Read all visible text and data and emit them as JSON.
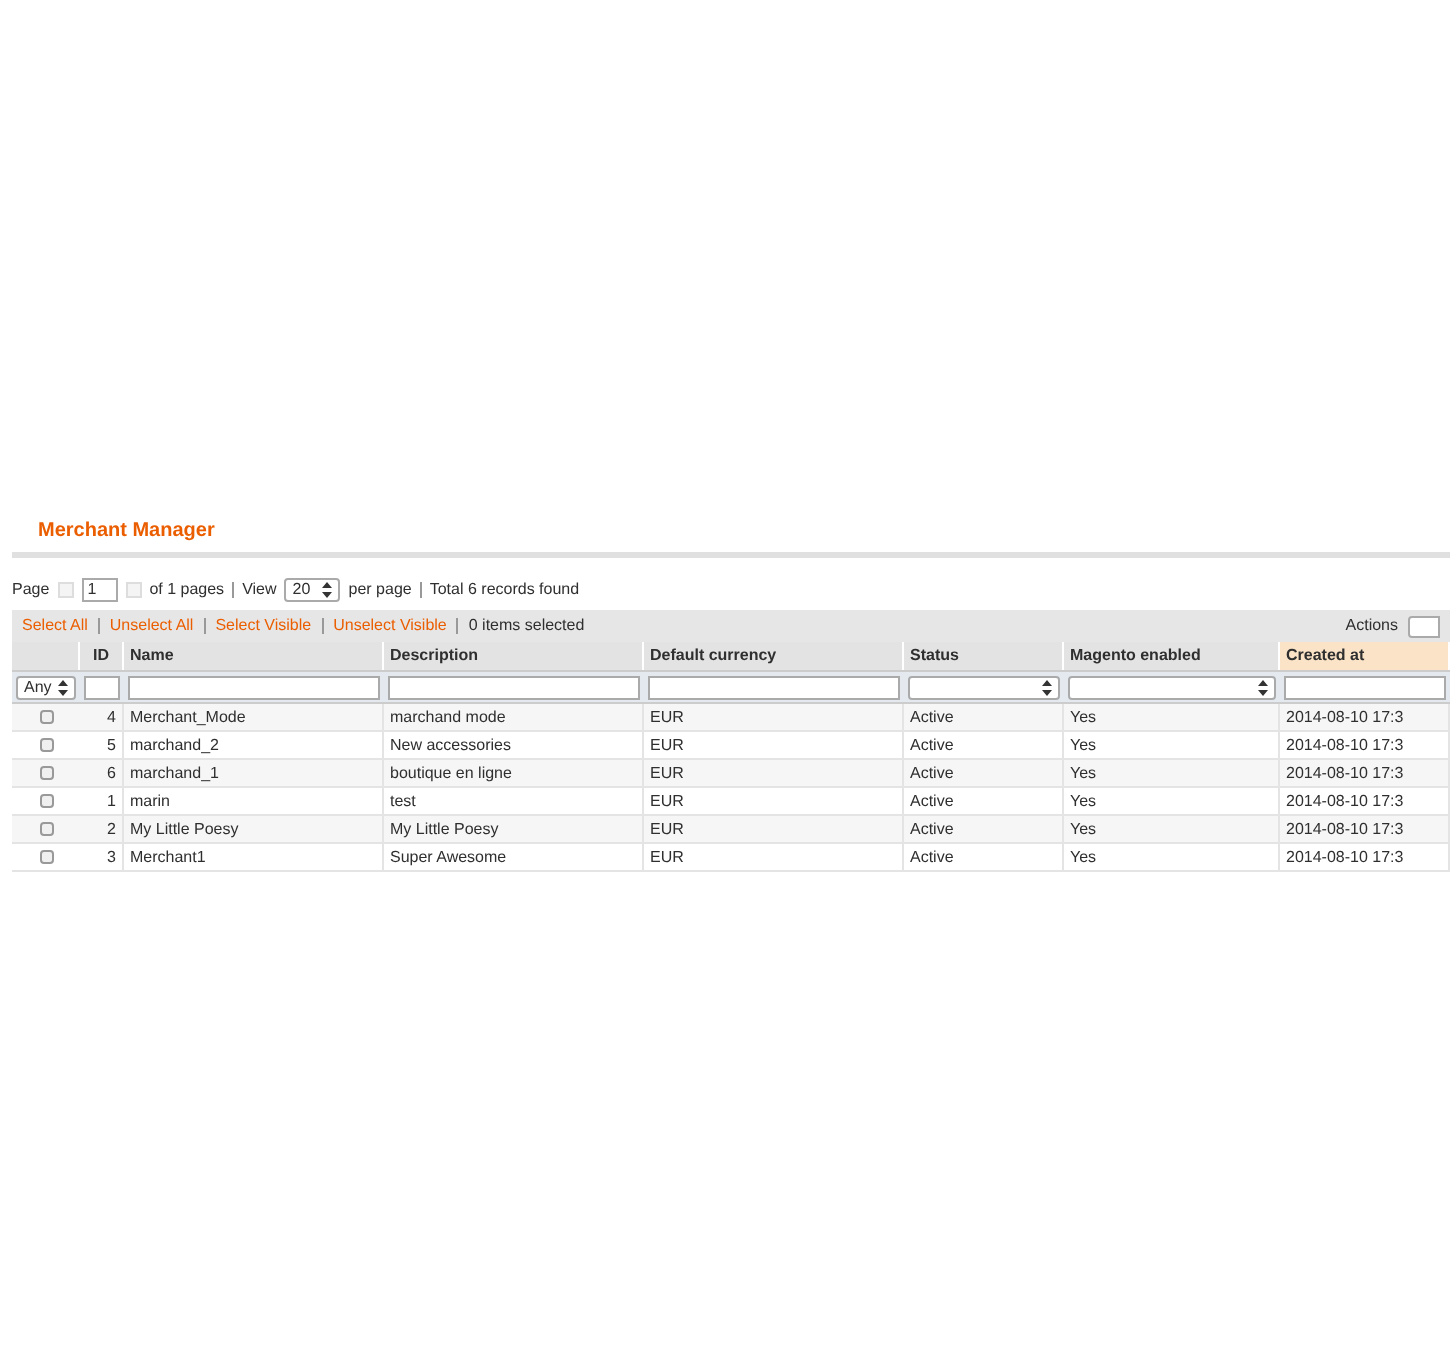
{
  "title": "Merchant Manager",
  "pager": {
    "page_label": "Page",
    "page": "1",
    "of_pages": "of 1 pages",
    "view_label": "View",
    "per_page": "20",
    "per_page_label": "per page",
    "total": "Total 6 records found"
  },
  "massaction": {
    "links": [
      "Select All",
      "Unselect All",
      "Select Visible",
      "Unselect Visible"
    ],
    "selected_count": "0 items selected",
    "actions_label": "Actions"
  },
  "table": {
    "columns": [
      {
        "label": "ID",
        "sorted": false
      },
      {
        "label": "Name",
        "sorted": false
      },
      {
        "label": "Description",
        "sorted": false
      },
      {
        "label": "Default currency",
        "sorted": false
      },
      {
        "label": "Status",
        "sorted": false
      },
      {
        "label": "Magento enabled",
        "sorted": false
      },
      {
        "label": "Created at",
        "sorted": true
      }
    ],
    "filters": [
      {
        "kind": "select",
        "value": "Any"
      },
      {
        "kind": "text"
      },
      {
        "kind": "text"
      },
      {
        "kind": "text"
      },
      {
        "kind": "text"
      },
      {
        "kind": "select"
      },
      {
        "kind": "select"
      },
      {
        "kind": "text"
      }
    ],
    "rows": [
      {
        "checked": false,
        "cells": [
          "4",
          "Merchant_Mode",
          "marchand mode",
          "EUR",
          "Active",
          "Yes",
          "2014-08-10 17:3"
        ]
      },
      {
        "checked": false,
        "cells": [
          "5",
          "marchand_2",
          "New accessories",
          "EUR",
          "Active",
          "Yes",
          "2014-08-10 17:3"
        ]
      },
      {
        "checked": false,
        "cells": [
          "6",
          "marchand_1",
          "boutique en ligne",
          "EUR",
          "Active",
          "Yes",
          "2014-08-10 17:3"
        ]
      },
      {
        "checked": false,
        "cells": [
          "1",
          "marin",
          "test",
          "EUR",
          "Active",
          "Yes",
          "2014-08-10 17:3"
        ]
      },
      {
        "checked": false,
        "cells": [
          "2",
          "My Little Poesy",
          "My Little Poesy",
          "EUR",
          "Active",
          "Yes",
          "2014-08-10 17:3"
        ]
      },
      {
        "checked": false,
        "cells": [
          "3",
          "Merchant1",
          "Super Awesome",
          "EUR",
          "Active",
          "Yes",
          "2014-08-10 17:3"
        ]
      }
    ]
  }
}
